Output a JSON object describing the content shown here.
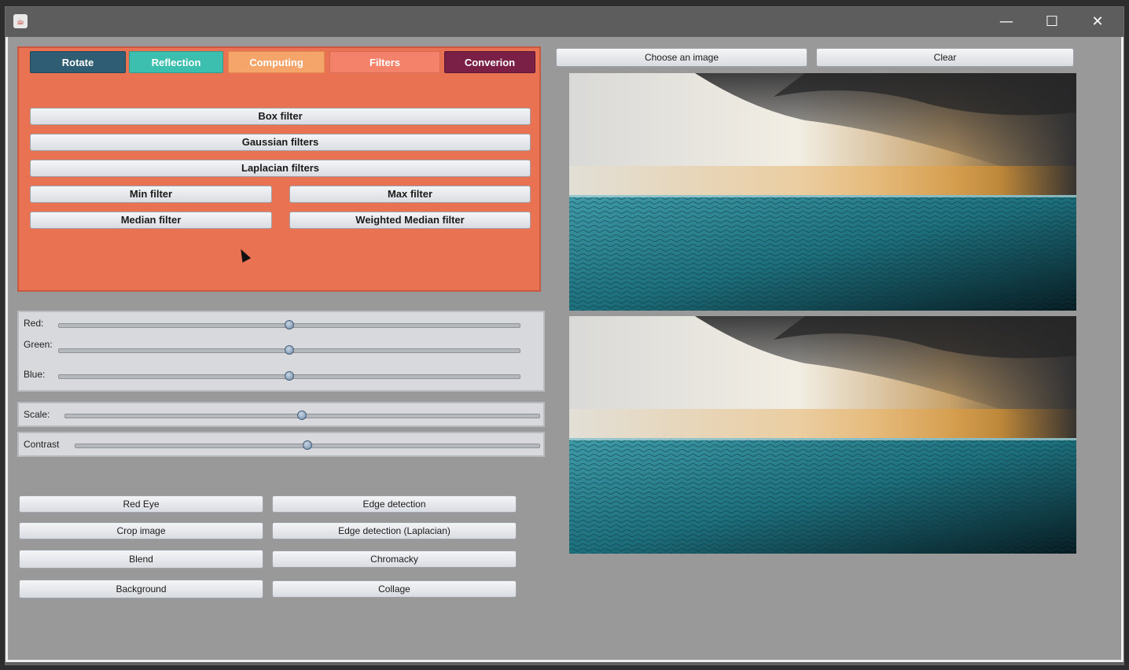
{
  "window": {
    "app_icon": "java-icon",
    "controls": {
      "minimize": "—",
      "maximize": "☐",
      "close": "✕"
    }
  },
  "tabs": [
    {
      "label": "Rotate",
      "color": "#2f5d73"
    },
    {
      "label": "Reflection",
      "color": "#3cbfae"
    },
    {
      "label": "Computing",
      "color": "#f6a56a"
    },
    {
      "label": "Filters",
      "color": "#f4826a"
    },
    {
      "label": "Conversion",
      "display": "Converion",
      "color": "#7a1f46"
    }
  ],
  "filters": {
    "box": "Box filter",
    "gaussian": "Gaussian filters",
    "laplacian": "Laplacian filters",
    "min": "Min filter",
    "max": "Max filter",
    "median": "Median filter",
    "weighted_median": "Weighted Median filter"
  },
  "rgb": {
    "red_label": "Red:",
    "green_label": "Green:",
    "blue_label": "Blue:",
    "red_value": 0.5,
    "green_value": 0.5,
    "blue_value": 0.5
  },
  "scale": {
    "label": "Scale:",
    "value": 0.5
  },
  "contrast": {
    "label": "Contrast",
    "value": 0.5
  },
  "actions": {
    "red_eye": "Red Eye",
    "edge_detection": "Edge detection",
    "crop_image": "Crop image",
    "edge_detection_laplacian": "Edge detection (Laplacian)",
    "blend": "Blend",
    "chromacky": "Chromacky",
    "background": "Background",
    "collage": "Collage"
  },
  "image_toolbar": {
    "choose": "Choose an image",
    "clear": "Clear"
  },
  "colors": {
    "filter_panel": "#e97253",
    "content_bg": "#999999",
    "window_bg": "#5d5d5d"
  }
}
